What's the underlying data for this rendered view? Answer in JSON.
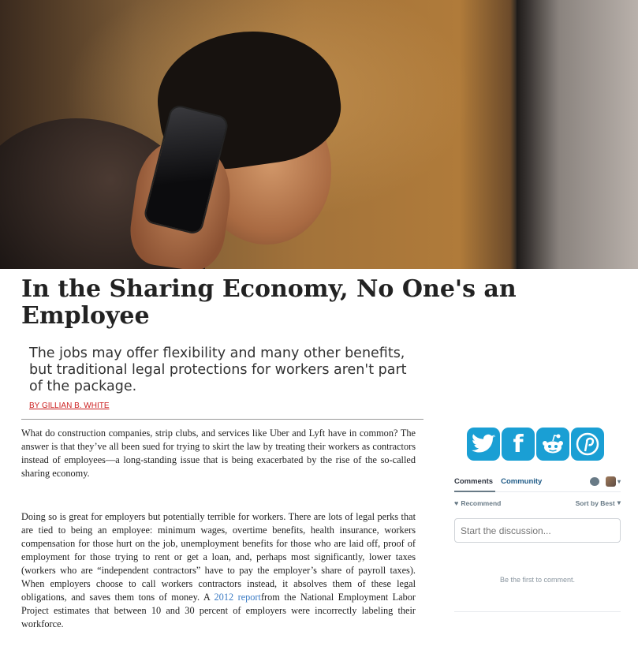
{
  "article": {
    "headline": "In the Sharing Economy, No One's an Employee",
    "dek": "The jobs may offer flexibility and many other benefits, but traditional legal protections for workers aren't part of the package.",
    "byline": "By GILLIAN B. WHITE",
    "paragraph1": "What do construction companies, strip clubs, and services like Uber and Lyft have in common? The answer is that they’ve all been sued for trying to skirt the law by treating their workers as contractors instead of employees—a long-standing issue that is being exacerbated by the rise of the so-called sharing economy.",
    "paragraph2_before": "Doing so is great for employers but potentially terrible for workers. There are lots of legal perks that are tied to being an employee: minimum wages, overtime benefits, health insurance, workers compensation for those hurt on the job, unemployment benefits for those who are laid off, proof of employment for those trying to rent or get a loan, and, perhaps most significantly, lower taxes (workers who are “independent contractors” have to pay the employer’s share of  payroll taxes). When employers choose to call workers contractors instead, it absolves them of these legal obligations, and saves them tons of money. A ",
    "paragraph2_link": "2012 report",
    "paragraph2_after": "from the National Employment Labor Project estimates that between 10 and 30 percent of employers were incorrectly labeling their workforce."
  },
  "social": {
    "twitter_glyph": "t",
    "facebook_glyph": "f",
    "reddit_glyph": "r",
    "pinterest_glyph": "P"
  },
  "comments": {
    "tab_comments": "Comments",
    "tab_community": "Community",
    "recommend_label": "Recommend",
    "sort_label": "Sort by Best",
    "discussion_placeholder": "Start the discussion...",
    "empty_text": "Be the first to comment."
  },
  "colors": {
    "social_blue": "#1a9fd4",
    "byline_red": "#cc1f1f",
    "link_blue": "#3b7bc4"
  }
}
